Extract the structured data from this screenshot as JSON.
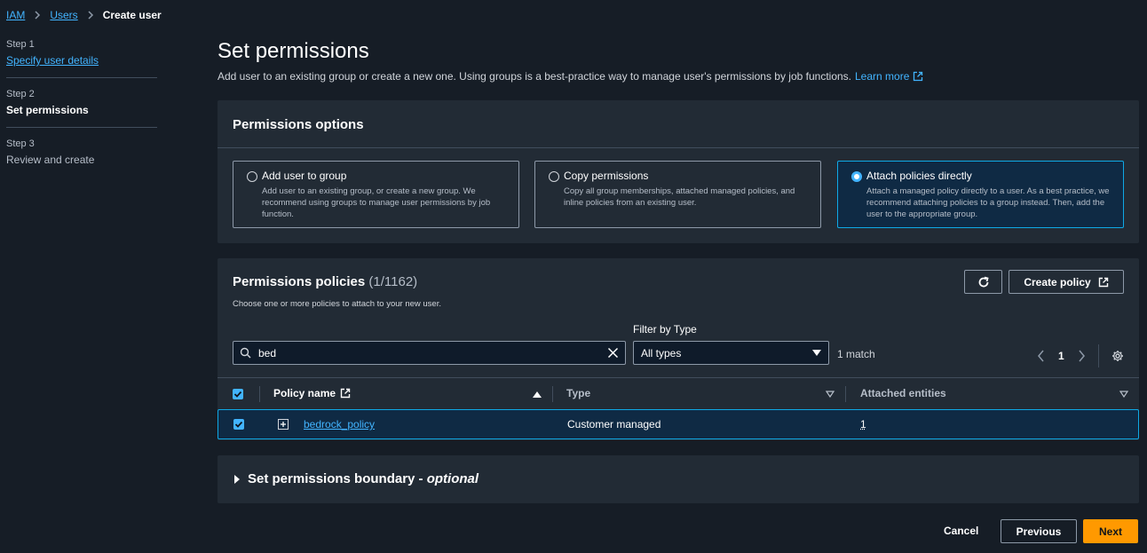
{
  "breadcrumb": {
    "iam": "IAM",
    "users": "Users",
    "current": "Create user"
  },
  "steps": [
    {
      "num": "Step 1",
      "label": "Specify user details"
    },
    {
      "num": "Step 2",
      "label": "Set permissions"
    },
    {
      "num": "Step 3",
      "label": "Review and create"
    }
  ],
  "header": {
    "title": "Set permissions",
    "description": "Add user to an existing group or create a new one. Using groups is a best-practice way to manage user's permissions by job functions.",
    "learn_more": "Learn more"
  },
  "permissions_options": {
    "title": "Permissions options",
    "options": [
      {
        "title": "Add user to group",
        "desc": "Add user to an existing group, or create a new group. We recommend using groups to manage user permissions by job function.",
        "selected": false
      },
      {
        "title": "Copy permissions",
        "desc": "Copy all group memberships, attached managed policies, and inline policies from an existing user.",
        "selected": false
      },
      {
        "title": "Attach policies directly",
        "desc": "Attach a managed policy directly to a user. As a best practice, we recommend attaching policies to a group instead. Then, add the user to the appropriate group.",
        "selected": true
      }
    ]
  },
  "policies": {
    "title": "Permissions policies",
    "count": "(1/1162)",
    "subtitle": "Choose one or more policies to attach to your new user.",
    "create_label": "Create policy",
    "filter_label": "Filter by Type",
    "search_value": "bed",
    "filter_value": "All types",
    "match_text": "1 match",
    "page": "1",
    "columns": {
      "name": "Policy name",
      "type": "Type",
      "entities": "Attached entities"
    },
    "rows": [
      {
        "name": "bedrock_policy",
        "type": "Customer managed",
        "entities": "1",
        "checked": true
      }
    ]
  },
  "boundary": {
    "title": "Set permissions boundary - ",
    "optional": "optional"
  },
  "footer": {
    "cancel": "Cancel",
    "previous": "Previous",
    "next": "Next"
  },
  "colors": {
    "accent": "#42b4ff",
    "primary_button": "#ff9900",
    "background": "#161d26",
    "panel": "#222b35"
  }
}
